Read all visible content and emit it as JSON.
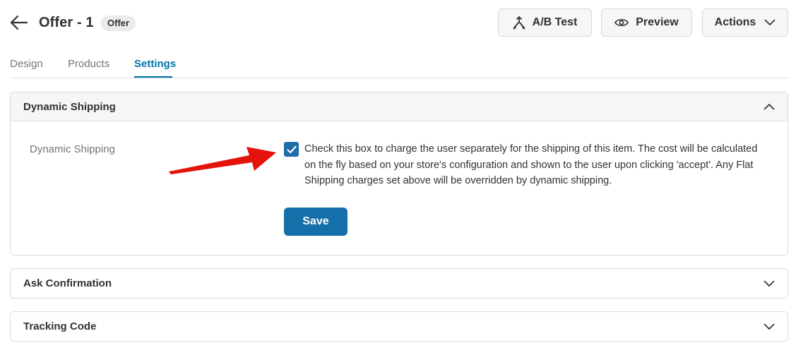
{
  "header": {
    "title": "Offer - 1",
    "badge": "Offer",
    "ab_test_label": "A/B Test",
    "preview_label": "Preview",
    "actions_label": "Actions"
  },
  "tabs": [
    {
      "label": "Design",
      "active": false
    },
    {
      "label": "Products",
      "active": false
    },
    {
      "label": "Settings",
      "active": true
    }
  ],
  "panels": {
    "dynamic_shipping": {
      "title": "Dynamic Shipping",
      "expanded": true,
      "field_label": "Dynamic Shipping",
      "checked": true,
      "help_text": "Check this box to charge the user separately for the shipping of this item. The cost will be calculated on the fly based on your store's configuration and shown to the user upon clicking 'accept'. Any Flat Shipping charges set above will be overridden by dynamic shipping.",
      "save_label": "Save"
    },
    "ask_confirmation": {
      "title": "Ask Confirmation",
      "expanded": false
    },
    "tracking_code": {
      "title": "Tracking Code",
      "expanded": false
    }
  },
  "colors": {
    "accent": "#0073aa",
    "save_button": "#156fa8",
    "annotation_arrow": "#e3120b"
  },
  "icons": {
    "back": "arrow-left-icon",
    "ab_test": "split-icon",
    "preview": "eye-icon",
    "actions": "chevron-down-icon",
    "panel_expanded": "chevron-up-icon",
    "panel_collapsed": "chevron-down-icon",
    "checkbox": "checkmark-icon"
  }
}
